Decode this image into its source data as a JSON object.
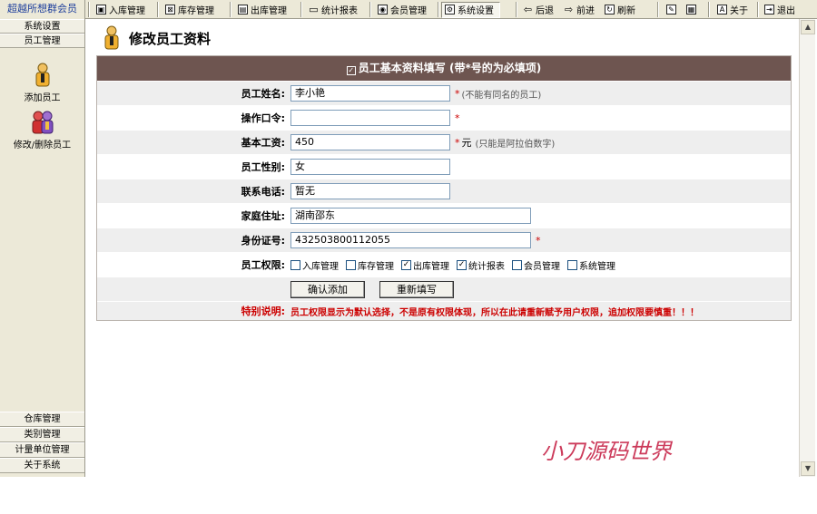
{
  "brand": "超越所想群会员",
  "toolbar": {
    "modules": [
      {
        "label": "入库管理",
        "icon": "box-icon"
      },
      {
        "label": "库存管理",
        "icon": "inventory-icon"
      },
      {
        "label": "出库管理",
        "icon": "outbound-icon"
      },
      {
        "label": "统计报表",
        "icon": "folder-icon"
      },
      {
        "label": "会员管理",
        "icon": "member-icon"
      },
      {
        "label": "系统设置",
        "icon": "settings-icon"
      }
    ],
    "nav": {
      "back": "后退",
      "forward": "前进",
      "refresh": "刷新"
    },
    "about": "关于",
    "exit": "退出"
  },
  "sidebar": {
    "tabs": [
      "系统设置",
      "员工管理"
    ],
    "items": [
      {
        "label": "添加员工",
        "icon": "add-employee-icon"
      },
      {
        "label": "修改/删除员工",
        "icon": "edit-employee-icon"
      }
    ],
    "bottom_tabs": [
      "仓库管理",
      "类别管理",
      "计量单位管理",
      "关于系统"
    ]
  },
  "page": {
    "title": "修改员工资料",
    "form_header": "员工基本资料填写 (带*号的为必填项)",
    "fields": {
      "name": {
        "label": "员工姓名:",
        "value": "李小艳",
        "required": "*",
        "hint": "(不能有同名的员工)"
      },
      "password": {
        "label": "操作口令:",
        "value": "",
        "required": "*"
      },
      "salary": {
        "label": "基本工资:",
        "value": "450",
        "required": "*",
        "unit": "元",
        "hint": "(只能是阿拉伯数字)"
      },
      "gender": {
        "label": "员工性别:",
        "value": "女"
      },
      "phone": {
        "label": "联系电话:",
        "value": "暂无"
      },
      "address": {
        "label": "家庭住址:",
        "value": "湖南邵东"
      },
      "id_card": {
        "label": "身份证号:",
        "value": "432503800112055",
        "required": "*"
      }
    },
    "permissions": {
      "label": "员工权限:",
      "options": [
        {
          "label": "入库管理",
          "checked": false
        },
        {
          "label": "库存管理",
          "checked": false
        },
        {
          "label": "出库管理",
          "checked": true
        },
        {
          "label": "统计报表",
          "checked": true
        },
        {
          "label": "会员管理",
          "checked": false
        },
        {
          "label": "系统管理",
          "checked": false
        }
      ]
    },
    "buttons": {
      "confirm": "确认添加",
      "reset": "重新填写"
    },
    "note": {
      "label": "特别说明:",
      "text": "员工权限显示为默认选择，不是原有权限体现，所以在此请重新赋予用户权限，追加权限要慎重！！！"
    }
  },
  "watermark": "小刀源码世界",
  "colors": {
    "header_bg": "#6e5550",
    "required": "#cc0000",
    "watermark": "#cc3a5a"
  }
}
